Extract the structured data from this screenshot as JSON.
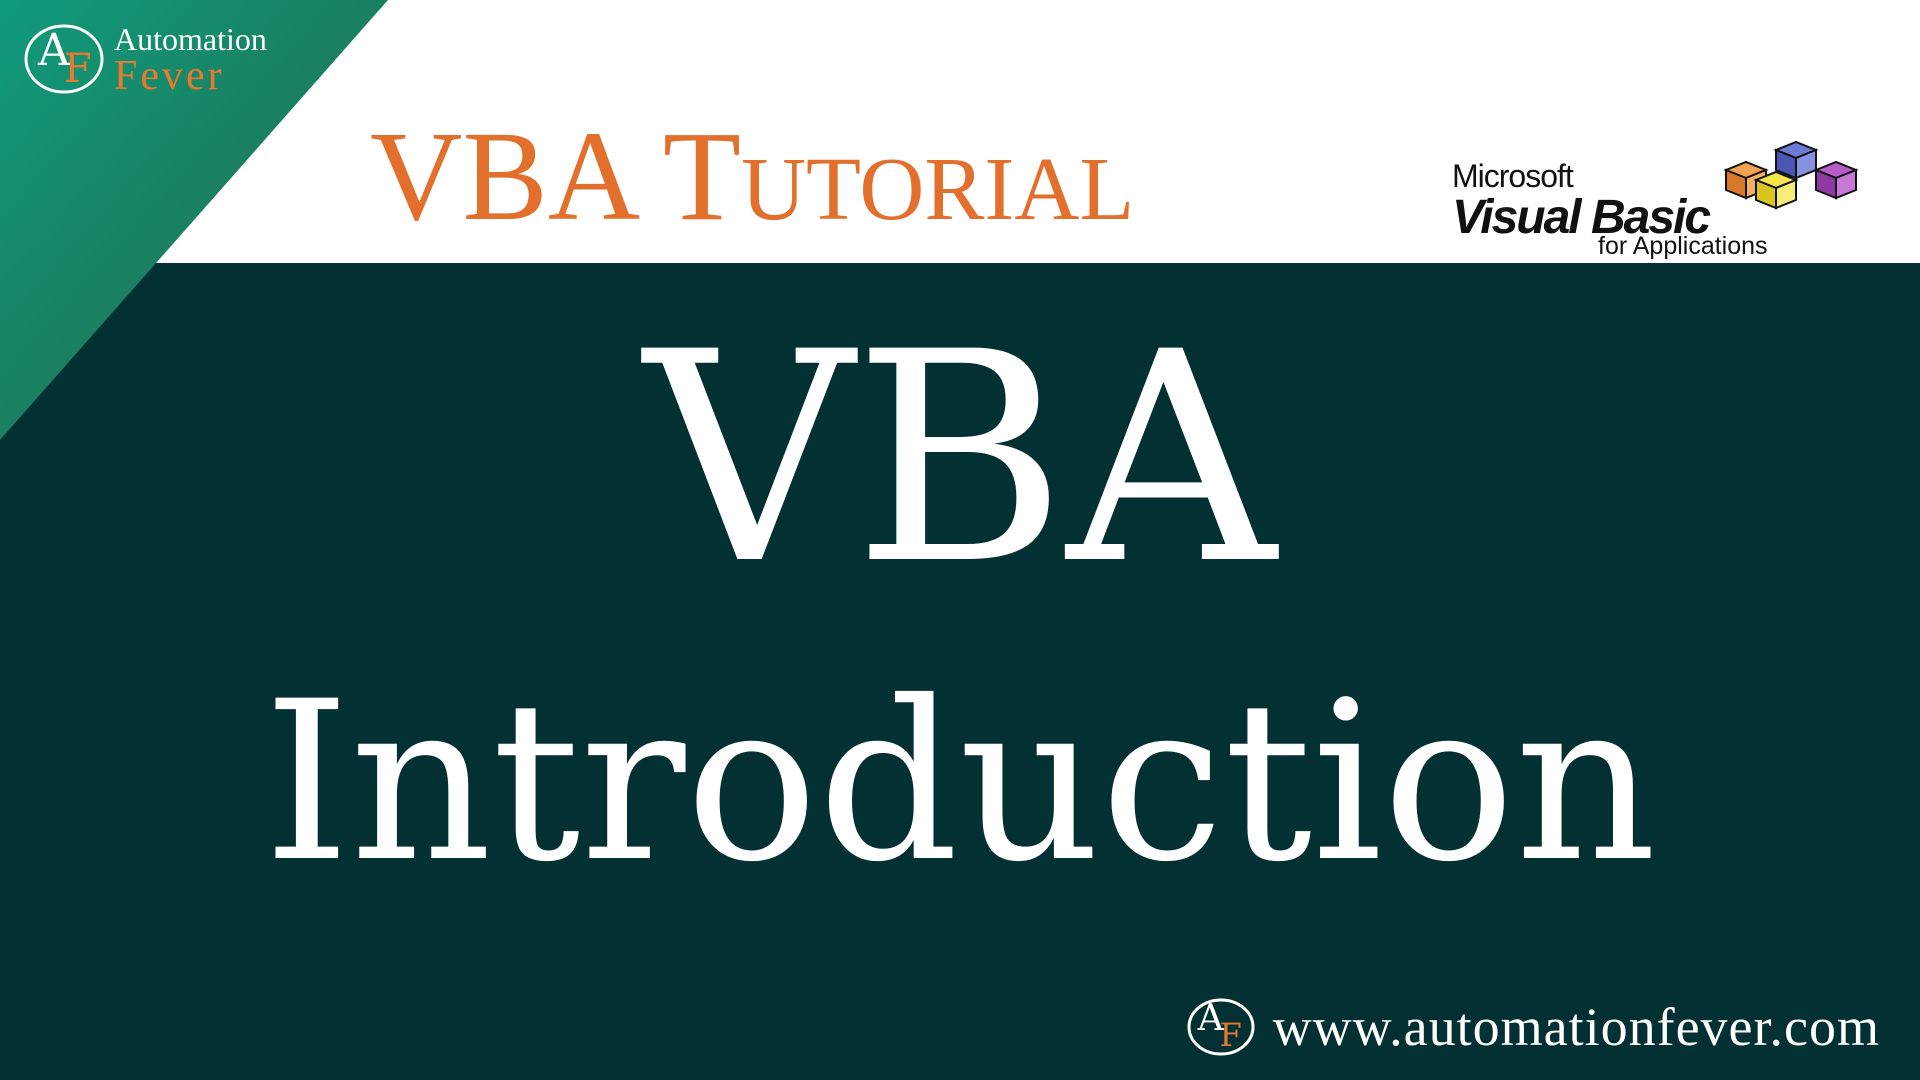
{
  "brand": {
    "top": "Automation",
    "bottom": "Fever",
    "logo_letter_a": "A",
    "logo_letter_f": "F"
  },
  "heading": "VBA Tutorial",
  "vba_logo": {
    "microsoft": "Microsoft",
    "visual_basic": "Visual Basic",
    "for_applications": "for Applications"
  },
  "title": {
    "line1": "VBA",
    "line2": "Introduction"
  },
  "footer": {
    "url": "www.automationfever.com"
  },
  "colors": {
    "dark_background": "#033133",
    "accent_orange": "#e2702c",
    "triangle_green": "#1a8a6e",
    "white": "#ffffff"
  }
}
